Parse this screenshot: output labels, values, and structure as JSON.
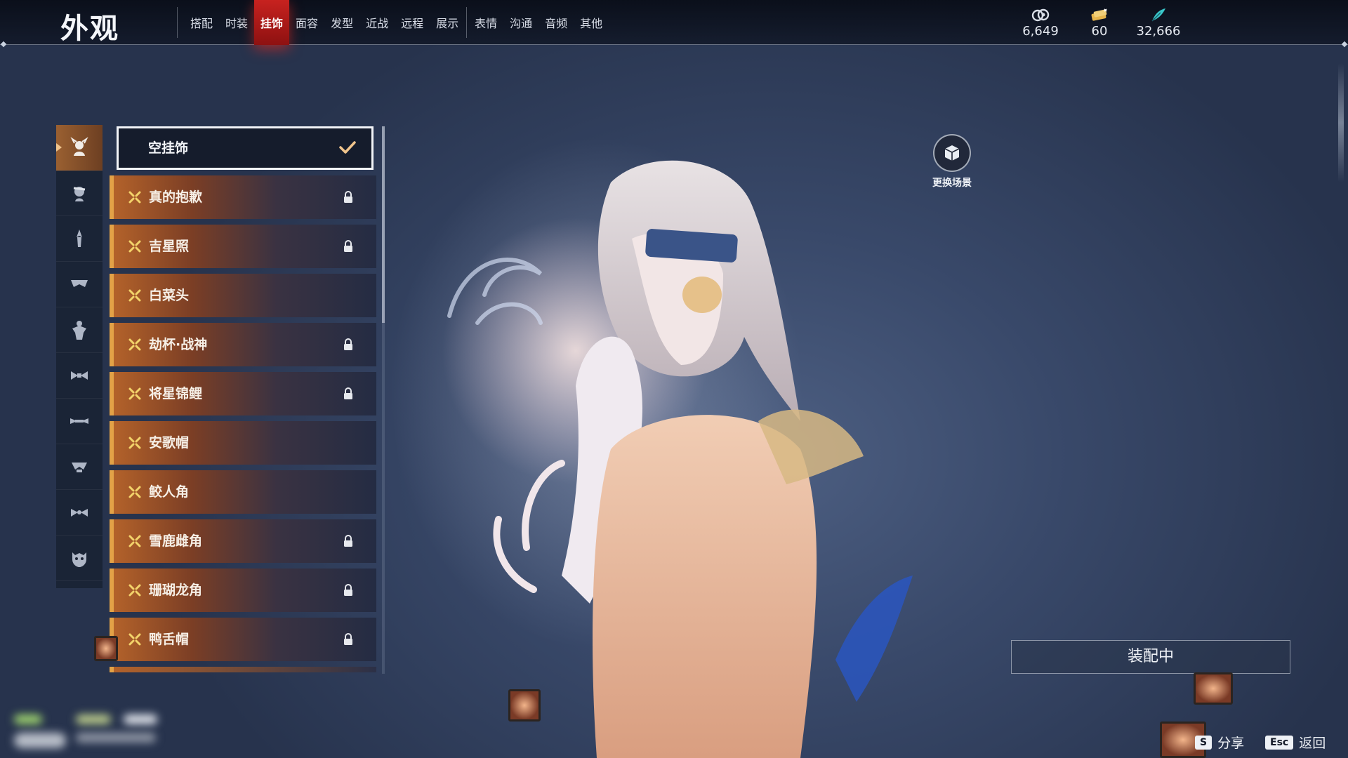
{
  "header": {
    "title": "外观",
    "tabs": [
      {
        "label": "搭配",
        "active": false
      },
      {
        "label": "时装",
        "active": false
      },
      {
        "label": "挂饰",
        "active": true
      },
      {
        "label": "面容",
        "active": false
      },
      {
        "label": "发型",
        "active": false
      },
      {
        "label": "近战",
        "active": false
      },
      {
        "label": "远程",
        "active": false
      },
      {
        "label": "展示",
        "active": false
      },
      {
        "label": "表情",
        "active": false
      },
      {
        "label": "沟通",
        "active": false
      },
      {
        "label": "音频",
        "active": false
      },
      {
        "label": "其他",
        "active": false
      }
    ]
  },
  "currencies": [
    {
      "icon": "coin-icon",
      "value": "6,649"
    },
    {
      "icon": "ticket-icon",
      "value": "60"
    },
    {
      "icon": "feather-icon",
      "value": "32,666"
    }
  ],
  "categories": [
    {
      "icon": "head-accessory-icon",
      "active": true
    },
    {
      "icon": "face-accessory-icon",
      "active": false
    },
    {
      "icon": "back-ornament-icon",
      "active": false
    },
    {
      "icon": "shoulder-icon",
      "active": false
    },
    {
      "icon": "cape-icon",
      "active": false
    },
    {
      "icon": "waist-icon",
      "active": false
    },
    {
      "icon": "hip-icon",
      "active": false
    },
    {
      "icon": "leg-icon",
      "active": false
    },
    {
      "icon": "ankle-icon",
      "active": false
    },
    {
      "icon": "mask-icon",
      "active": false
    }
  ],
  "items": [
    {
      "label": "空挂饰",
      "selected": true,
      "locked": false
    },
    {
      "label": "真的抱歉",
      "selected": false,
      "locked": true
    },
    {
      "label": "吉星照",
      "selected": false,
      "locked": true
    },
    {
      "label": "白菜头",
      "selected": false,
      "locked": false
    },
    {
      "label": "劫杯·战神",
      "selected": false,
      "locked": true
    },
    {
      "label": "将星锦鲤",
      "selected": false,
      "locked": true
    },
    {
      "label": "安歌帽",
      "selected": false,
      "locked": false
    },
    {
      "label": "鲛人角",
      "selected": false,
      "locked": false
    },
    {
      "label": "雪鹿雌角",
      "selected": false,
      "locked": true
    },
    {
      "label": "珊瑚龙角",
      "selected": false,
      "locked": true
    },
    {
      "label": "鸭舌帽",
      "selected": false,
      "locked": true
    }
  ],
  "scene": {
    "label": "更换场景"
  },
  "equip": {
    "label": "装配中"
  },
  "keys": [
    {
      "key": "S",
      "label": "分享"
    },
    {
      "key": "Esc",
      "label": "返回"
    }
  ],
  "colors": {
    "accent_red": "#c7221f",
    "item_orange": "#b3622a",
    "item_border": "#e3a247"
  }
}
